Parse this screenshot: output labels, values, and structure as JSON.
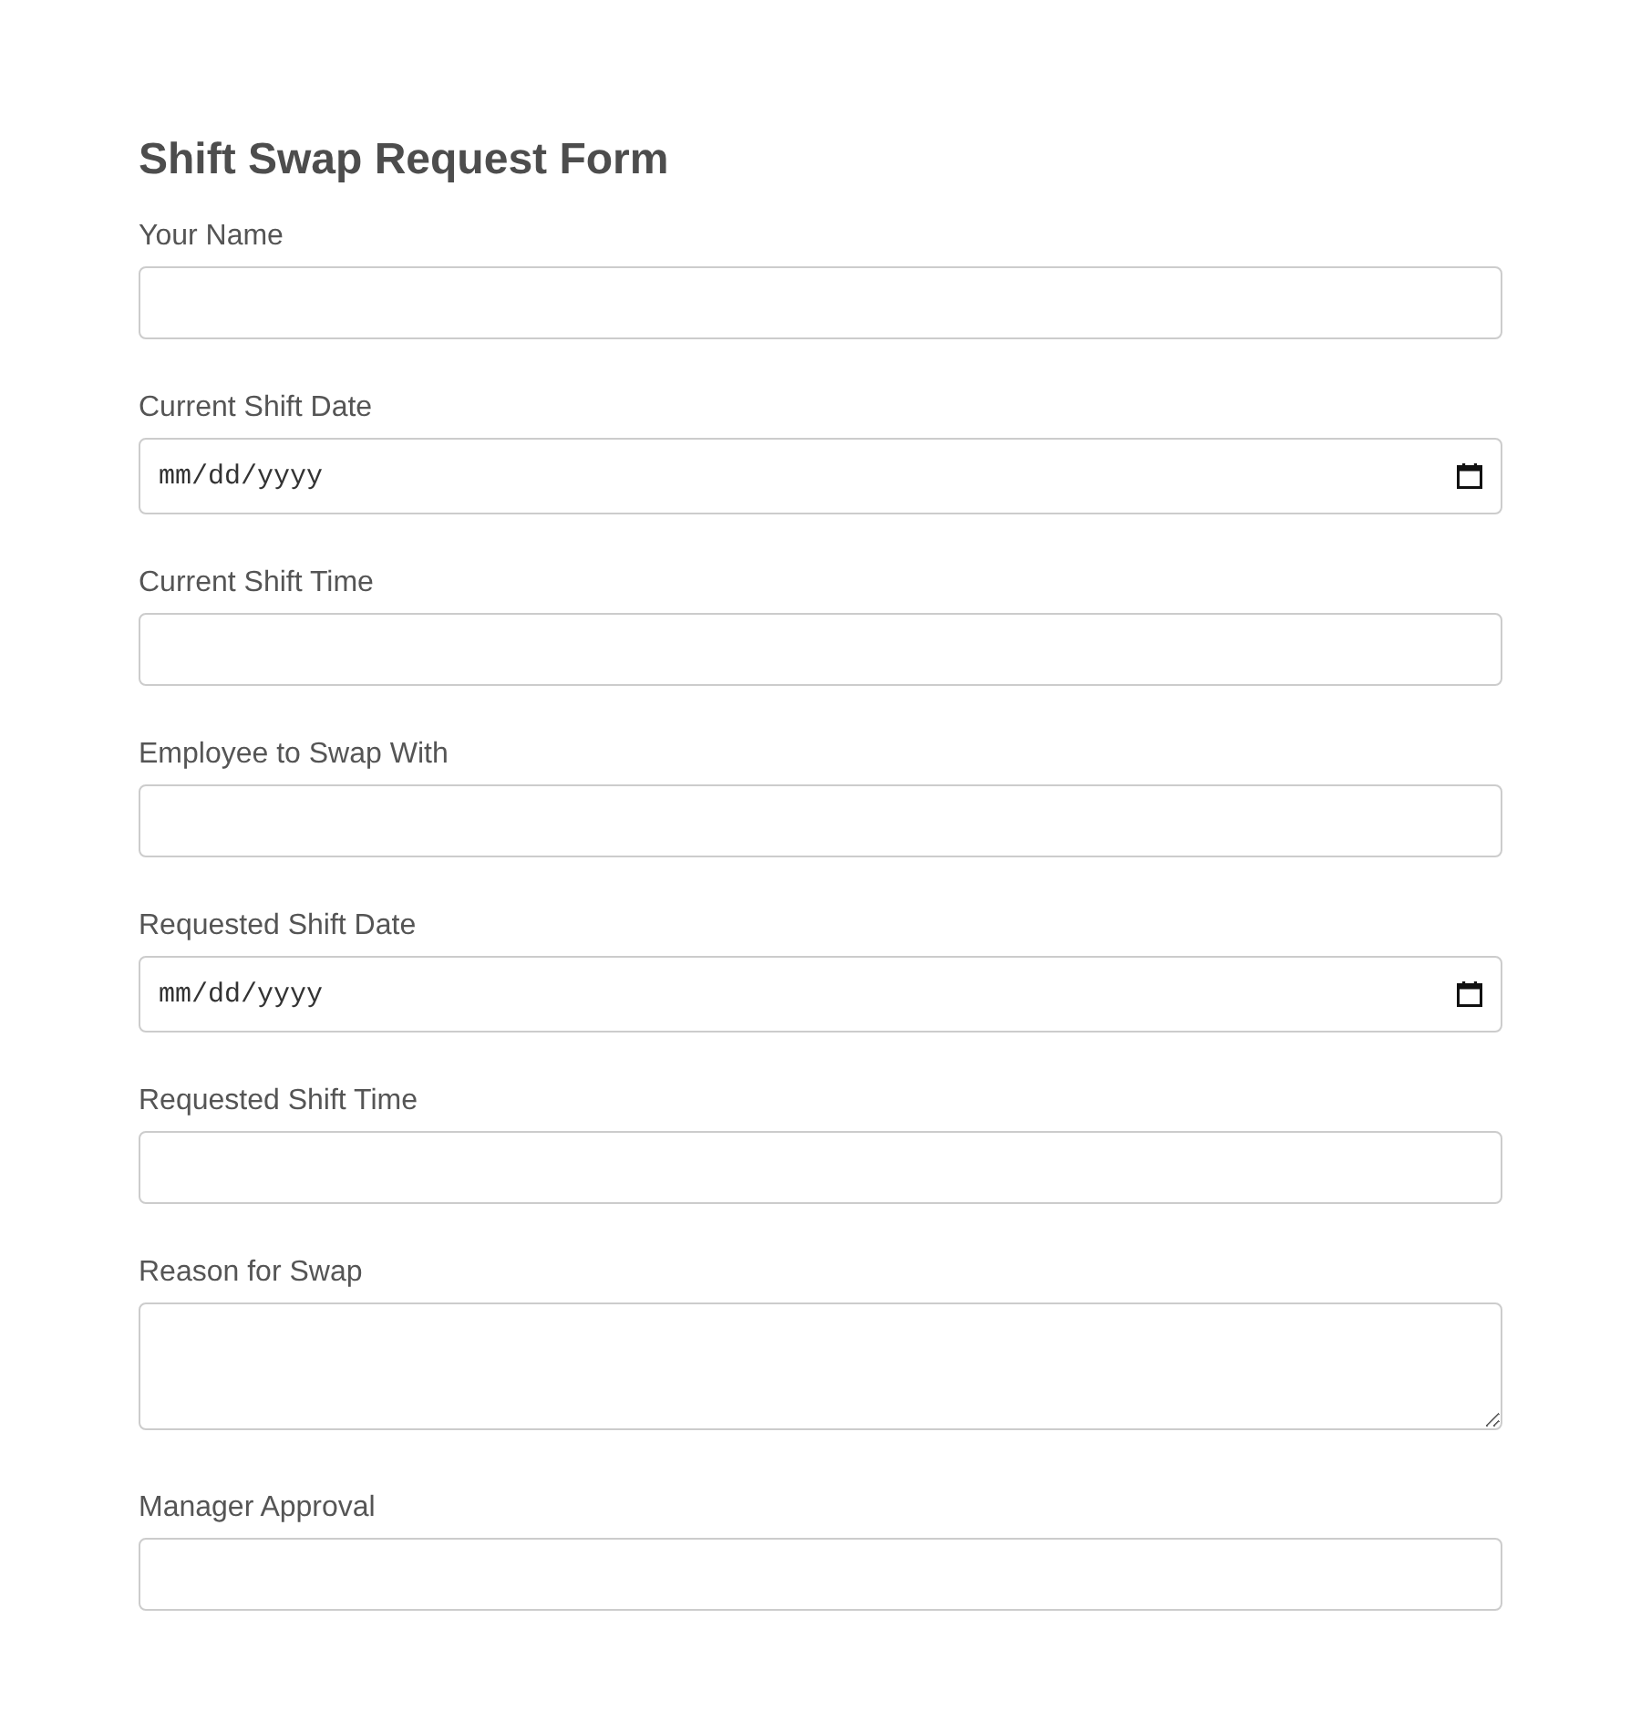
{
  "title": "Shift Swap Request Form",
  "fields": [
    {
      "label": "Your Name",
      "kind": "text"
    },
    {
      "label": "Current Shift Date",
      "kind": "date",
      "placeholder": "mm/dd/yyyy"
    },
    {
      "label": "Current Shift Time",
      "kind": "text"
    },
    {
      "label": "Employee to Swap With",
      "kind": "text"
    },
    {
      "label": "Requested Shift Date",
      "kind": "date",
      "placeholder": "mm/dd/yyyy"
    },
    {
      "label": "Requested Shift Time",
      "kind": "text"
    },
    {
      "label": "Reason for Swap",
      "kind": "textarea"
    },
    {
      "label": "Manager Approval",
      "kind": "text"
    }
  ]
}
